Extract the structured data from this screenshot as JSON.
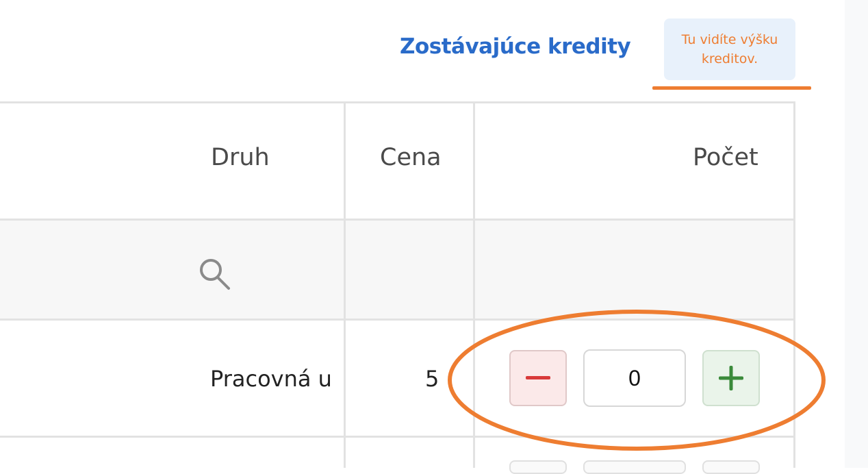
{
  "header": {
    "credits_title": "Zostávajúce kredity",
    "tooltip_text": "Tu vidíte výšku kreditov."
  },
  "table": {
    "columns": [
      "Druh",
      "Cena",
      "Počet"
    ],
    "rows": [
      {
        "druh": "Pracovná u",
        "cena": "5",
        "pocet": "0"
      }
    ]
  },
  "controls": {
    "decrement_symbol": "−",
    "increment_symbol": "+"
  },
  "icons": {
    "filter_search": "search-icon",
    "decrement": "minus-icon",
    "increment": "plus-icon"
  },
  "colors": {
    "accent_blue": "#2a6bc9",
    "annotation_orange": "#ee7d31",
    "minus_red": "#d83a3a",
    "plus_green": "#3a8a3a"
  }
}
